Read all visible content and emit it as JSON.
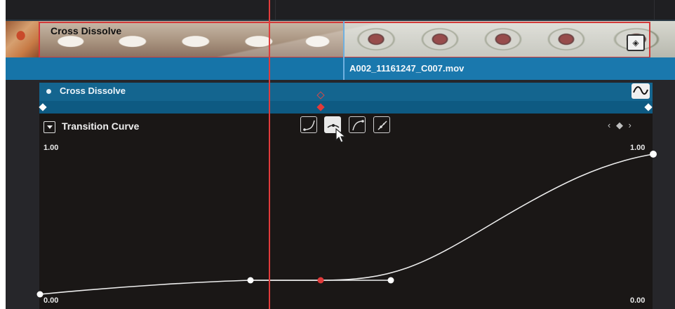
{
  "clip": {
    "transition_label": "Cross Dissolve",
    "incoming_clip_name": "A002_11161247_C007.mov"
  },
  "inspector": {
    "header_title": "Cross Dissolve",
    "curve_section_title": "Transition Curve",
    "keyframe_nav": "‹ ◆ ›"
  },
  "graph": {
    "top_left_value": "1.00",
    "top_right_value": "1.00",
    "bottom_left_value": "0.00",
    "bottom_right_value": "0.00"
  },
  "ease_presets": [
    "ease-in",
    "ease-in-out",
    "ease-out",
    "linear"
  ],
  "active_ease_preset": "ease-in-out",
  "colors": {
    "playhead": "#e13b3b",
    "clip_bar": "#1674a8",
    "selection": "#d33a3a"
  }
}
